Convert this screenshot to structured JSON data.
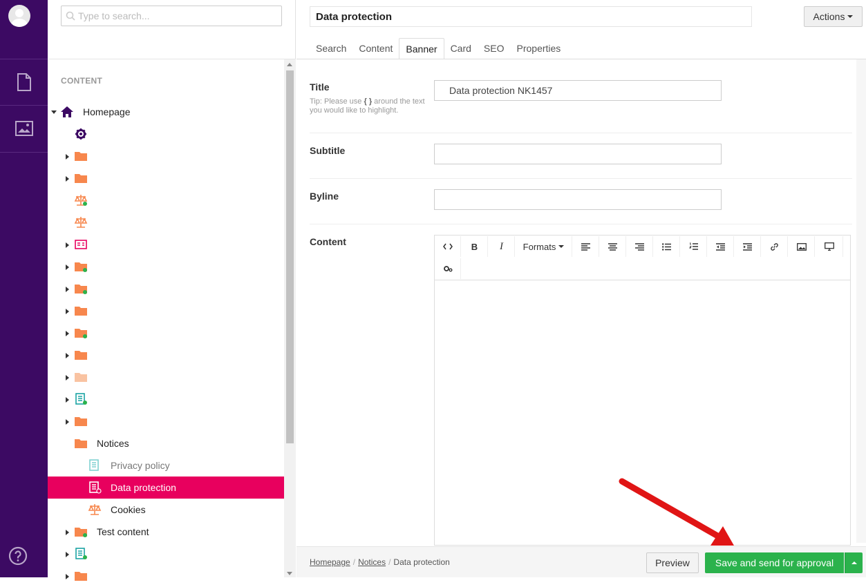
{
  "search": {
    "placeholder": "Type to search..."
  },
  "tree": {
    "heading": "CONTENT",
    "root": "Homepage",
    "notices": "Notices",
    "notice_children": [
      "Privacy policy",
      "Data protection",
      "Cookies"
    ],
    "test_content": "Test content"
  },
  "editor": {
    "node_name": "Data protection",
    "actions_label": "Actions",
    "tabs": [
      "Search",
      "Content",
      "Banner",
      "Card",
      "SEO",
      "Properties"
    ],
    "active_tab": "Banner",
    "fields": {
      "title_label": "Title",
      "title_value": "Data protection NK1457",
      "title_tip_pre": "Tip: Please use",
      "title_tip_braces": "{ }",
      "title_tip_post": "around the text you would like to highlight.",
      "subtitle_label": "Subtitle",
      "subtitle_value": "",
      "byline_label": "Byline",
      "byline_value": "",
      "content_label": "Content"
    },
    "rte": {
      "formats_label": "Formats"
    }
  },
  "footer": {
    "breadcrumbs": [
      "Homepage",
      "Notices",
      "Data protection"
    ],
    "preview_label": "Preview",
    "save_label": "Save and send for approval"
  },
  "colors": {
    "rail": "#3c0a63",
    "selected": "#e8005e",
    "folder": "#f7874d",
    "save": "#2bb24c",
    "arrow": "#e01515"
  }
}
